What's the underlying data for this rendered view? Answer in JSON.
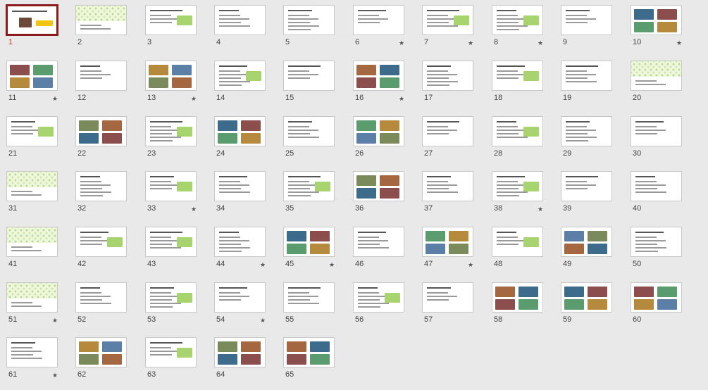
{
  "view": "slide-sorter",
  "slides": [
    {
      "n": "1",
      "star": ""
    },
    {
      "n": "2",
      "star": ""
    },
    {
      "n": "3",
      "star": ""
    },
    {
      "n": "4",
      "star": ""
    },
    {
      "n": "5",
      "star": ""
    },
    {
      "n": "6",
      "star": "★"
    },
    {
      "n": "7",
      "star": "★"
    },
    {
      "n": "8",
      "star": "★"
    },
    {
      "n": "9",
      "star": ""
    },
    {
      "n": "10",
      "star": "★"
    },
    {
      "n": "11",
      "star": "★"
    },
    {
      "n": "12",
      "star": ""
    },
    {
      "n": "13",
      "star": "★"
    },
    {
      "n": "14",
      "star": ""
    },
    {
      "n": "15",
      "star": ""
    },
    {
      "n": "16",
      "star": "★"
    },
    {
      "n": "17",
      "star": ""
    },
    {
      "n": "18",
      "star": ""
    },
    {
      "n": "19",
      "star": ""
    },
    {
      "n": "20",
      "star": ""
    },
    {
      "n": "21",
      "star": ""
    },
    {
      "n": "22",
      "star": ""
    },
    {
      "n": "23",
      "star": ""
    },
    {
      "n": "24",
      "star": ""
    },
    {
      "n": "25",
      "star": ""
    },
    {
      "n": "26",
      "star": ""
    },
    {
      "n": "27",
      "star": ""
    },
    {
      "n": "28",
      "star": ""
    },
    {
      "n": "29",
      "star": ""
    },
    {
      "n": "30",
      "star": ""
    },
    {
      "n": "31",
      "star": ""
    },
    {
      "n": "32",
      "star": ""
    },
    {
      "n": "33",
      "star": "★"
    },
    {
      "n": "34",
      "star": ""
    },
    {
      "n": "35",
      "star": ""
    },
    {
      "n": "36",
      "star": ""
    },
    {
      "n": "37",
      "star": ""
    },
    {
      "n": "38",
      "star": "★"
    },
    {
      "n": "39",
      "star": ""
    },
    {
      "n": "40",
      "star": ""
    },
    {
      "n": "41",
      "star": ""
    },
    {
      "n": "42",
      "star": ""
    },
    {
      "n": "43",
      "star": ""
    },
    {
      "n": "44",
      "star": "★"
    },
    {
      "n": "45",
      "star": "★"
    },
    {
      "n": "46",
      "star": ""
    },
    {
      "n": "47",
      "star": "★"
    },
    {
      "n": "48",
      "star": ""
    },
    {
      "n": "49",
      "star": ""
    },
    {
      "n": "50",
      "star": ""
    },
    {
      "n": "51",
      "star": "★"
    },
    {
      "n": "52",
      "star": ""
    },
    {
      "n": "53",
      "star": ""
    },
    {
      "n": "54",
      "star": "★"
    },
    {
      "n": "55",
      "star": ""
    },
    {
      "n": "56",
      "star": ""
    },
    {
      "n": "57",
      "star": ""
    },
    {
      "n": "58",
      "star": ""
    },
    {
      "n": "59",
      "star": ""
    },
    {
      "n": "60",
      "star": ""
    },
    {
      "n": "61",
      "star": "★"
    },
    {
      "n": "62",
      "star": ""
    },
    {
      "n": "63",
      "star": ""
    },
    {
      "n": "64",
      "star": ""
    },
    {
      "n": "65",
      "star": ""
    }
  ],
  "selected_slide": "1",
  "colors": {
    "background": "#e9e9e9",
    "selection_border": "#8b1a1a",
    "selected_number": "#c0392b",
    "accent_green": "#7ab648"
  }
}
